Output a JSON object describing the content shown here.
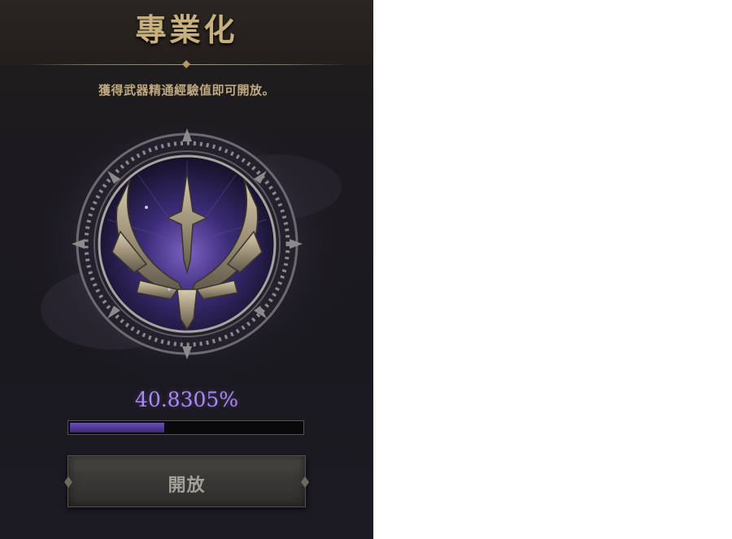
{
  "panel": {
    "title": "專業化",
    "subtitle": "獲得武器精通經驗值即可開放。"
  },
  "emblem": {
    "icon": "specialization-emblem-icon"
  },
  "progress": {
    "percent_text": "40.8305%",
    "fraction": 0.408305
  },
  "open_button": {
    "label": "開放"
  },
  "colors": {
    "title_gold": "#c8b07e",
    "subtitle_gold": "#bfa982",
    "percent_purple": "#a98bea",
    "bar_fill_purple": "#4d3791",
    "panel_bg": "#1c1a1f"
  }
}
